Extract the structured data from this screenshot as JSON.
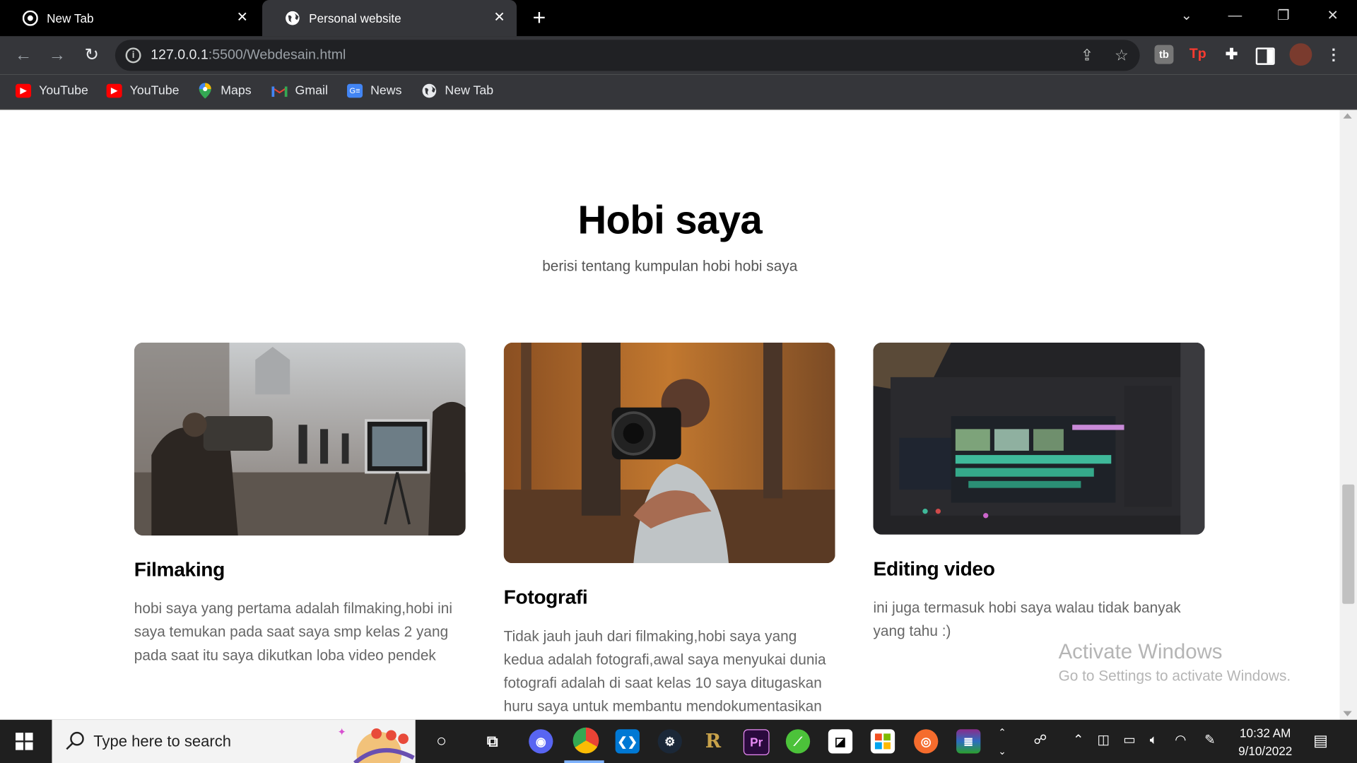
{
  "browser": {
    "tabs": [
      {
        "title": "New Tab",
        "active": false
      },
      {
        "title": "Personal website",
        "active": true
      }
    ],
    "url_host": "127.0.0.1",
    "url_path": ":5500/Webdesain.html",
    "bookmarks": [
      {
        "label": "YouTube",
        "icon": "youtube-icon"
      },
      {
        "label": "YouTube",
        "icon": "youtube-icon"
      },
      {
        "label": "Maps",
        "icon": "maps-icon"
      },
      {
        "label": "Gmail",
        "icon": "gmail-icon"
      },
      {
        "label": "News",
        "icon": "news-icon"
      },
      {
        "label": "New Tab",
        "icon": "globe-icon"
      }
    ]
  },
  "page": {
    "heading": "Hobi saya",
    "subheading": "berisi tentang kumpulan hobi hobi saya",
    "cards": [
      {
        "title": "Filmaking",
        "text": "hobi saya yang pertama adalah filmaking,hobi ini saya temukan pada saat saya smp kelas 2 yang pada saat itu saya dikutkan loba video pendek",
        "image": "film-crew-photo"
      },
      {
        "title": "Fotografi",
        "text": "Tidak jauh jauh dari filmaking,hobi saya yang kedua adalah fotografi,awal saya menyukai dunia fotografi adalah di saat kelas 10 saya ditugaskan huru saya untuk membantu mendokumentasikan",
        "image": "camera-forest-photo"
      },
      {
        "title": "Editing video",
        "text": "ini juga termasuk hobi saya walau tidak banyak yang tahu :)",
        "image": "video-editor-photo"
      }
    ]
  },
  "watermark": {
    "line1": "Activate Windows",
    "line2": "Go to Settings to activate Windows."
  },
  "taskbar": {
    "search_placeholder": "Type here to search",
    "time": "10:32 AM",
    "date": "9/10/2022"
  }
}
